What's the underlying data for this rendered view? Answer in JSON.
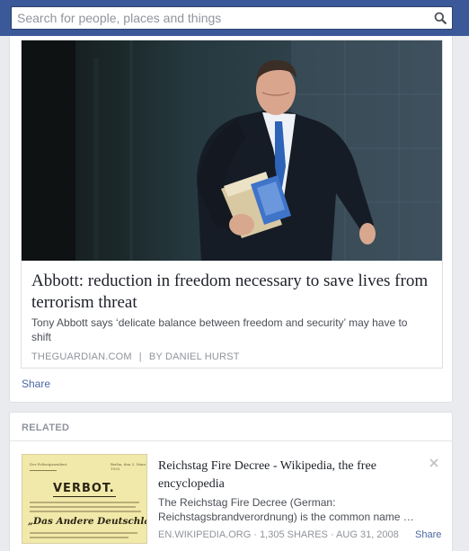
{
  "search": {
    "placeholder": "Search for people, places and things",
    "button_icon": "search-icon"
  },
  "post": {
    "headline": "Abbott: reduction in freedom necessary to save lives from terrorism threat",
    "summary": "Tony Abbott says ‘delicate balance between freedom and security’ may have to shift",
    "source": "THEGUARDIAN.COM",
    "separator": "|",
    "byline": "BY DANIEL HURST",
    "share_label": "Share",
    "photo_icon": "photo-icon"
  },
  "related": {
    "header": "RELATED",
    "item": {
      "title": "Reichstag Fire Decree - Wikipedia, the free encyclopedia",
      "description": "The Reichstag Fire Decree (German: Reichstagsbrandverordnung) is the common name …",
      "meta": "EN.WIKIPEDIA.ORG · 1,305 SHARES · AUG 31, 2008",
      "share_label": "Share",
      "close_icon": "close-icon",
      "thumb": {
        "headline": "VERBOT.",
        "banner": "„Das Andere Deutschland“"
      }
    }
  },
  "colors": {
    "brand_blue": "#3b5998",
    "link_blue": "#4b67a1",
    "background": "#e9ebee"
  }
}
